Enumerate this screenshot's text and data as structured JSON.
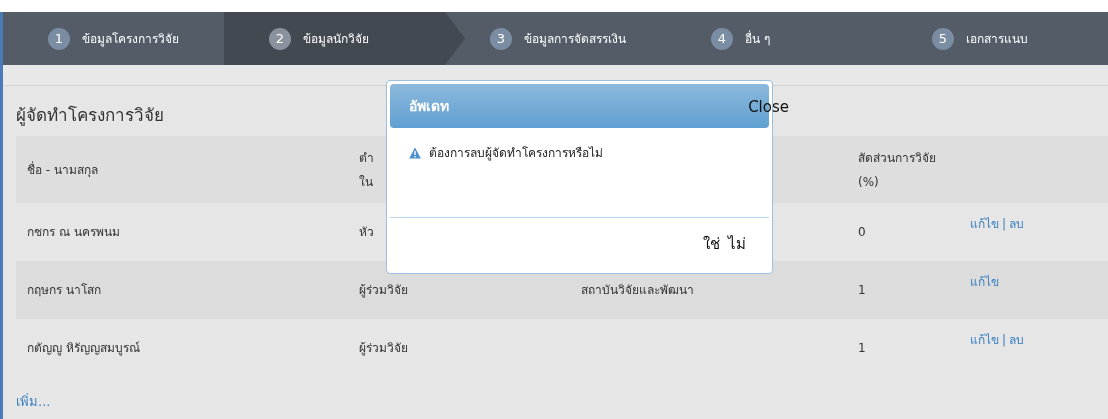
{
  "steps": [
    {
      "number": "1",
      "label": "ข้อมูลโครงการวิจัย",
      "selected": false
    },
    {
      "number": "2",
      "label": "ข้อมูลนักวิจัย",
      "selected": true
    },
    {
      "number": "3",
      "label": "ข้อมูลการจัดสรรเงิน",
      "selected": false
    },
    {
      "number": "4",
      "label": "อื่น ๆ",
      "selected": false
    },
    {
      "number": "5",
      "label": "เอกสารแนบ",
      "selected": false
    }
  ],
  "section": {
    "title": "ผู้จัดทำโครงการวิจัย",
    "table": {
      "columns": [
        {
          "lines": [
            "ชื่อ - นามสกุล"
          ]
        },
        {
          "lines": [
            "ตำ",
            "ใน"
          ]
        },
        {},
        {
          "lines": [
            "สัดส่วนการวิจัย",
            "(%)"
          ]
        }
      ],
      "rows": [
        {
          "cells": [
            "กชกร ณ นครพนม",
            "หัว",
            "",
            "0"
          ],
          "actions": [
            "แก้ไข",
            "ลบ"
          ],
          "separator": "|"
        },
        {
          "cells": [
            "กฤษกร นาโสก",
            "ผู้ร่วมวิจัย",
            "สถาบันวิจัยและพัฒนา",
            "1"
          ],
          "actions": [
            "แก้ไข"
          ]
        },
        {
          "cells": [
            "กตัญญู หิรัญญสมบูรณ์",
            "ผู้ร่วมวิจัย",
            "",
            "1"
          ],
          "actions": [
            "แก้ไข",
            "ลบ"
          ],
          "separator": "|"
        }
      ]
    },
    "add_link": "เพิ่ม..."
  },
  "dialog": {
    "title": "อัพเดท",
    "close": "Close",
    "message": "ต้องการลบผู้จัดทำโครงการหรือไม่",
    "buttons": [
      "ใช่",
      "ไม่"
    ]
  }
}
